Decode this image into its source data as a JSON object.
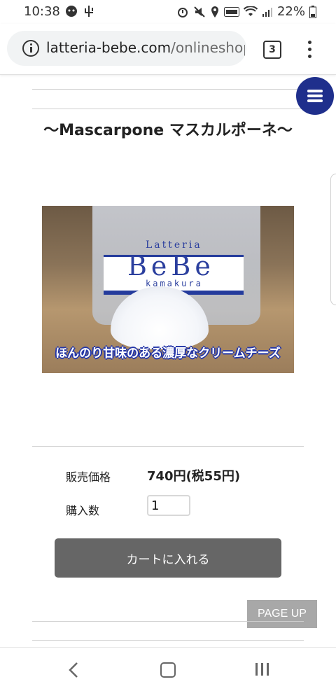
{
  "status_bar": {
    "time": "10:38",
    "battery_percent": "22%",
    "left_icons": [
      "notification-icon",
      "usb-icon"
    ],
    "right_icons": [
      "alarm-icon",
      "mute-icon",
      "location-icon",
      "volte-icon",
      "wifi-icon",
      "signal-icon",
      "battery-icon"
    ]
  },
  "browser": {
    "url_domain": "latteria-bebe.com",
    "url_path": "/onlineshop",
    "tab_count": "3"
  },
  "product": {
    "title": "〜Mascarpone マスカルポーネ〜",
    "image": {
      "brand_top": "Latteria",
      "brand": "BeBe",
      "brand_sub": "kamakura",
      "caption": "ほんのり甘味のある濃厚なクリームチーズ"
    },
    "price_label": "販売価格",
    "price_value": "740円(税55円)",
    "quantity_label": "購入数",
    "quantity_value": "1",
    "cart_button": "カートに入れる"
  },
  "page_up_label": "PAGE UP",
  "colors": {
    "menu_button": "#1f2f8c",
    "cart_button": "#666666",
    "page_up": "#a8a8a8",
    "caption_outline": "#2436a8"
  }
}
